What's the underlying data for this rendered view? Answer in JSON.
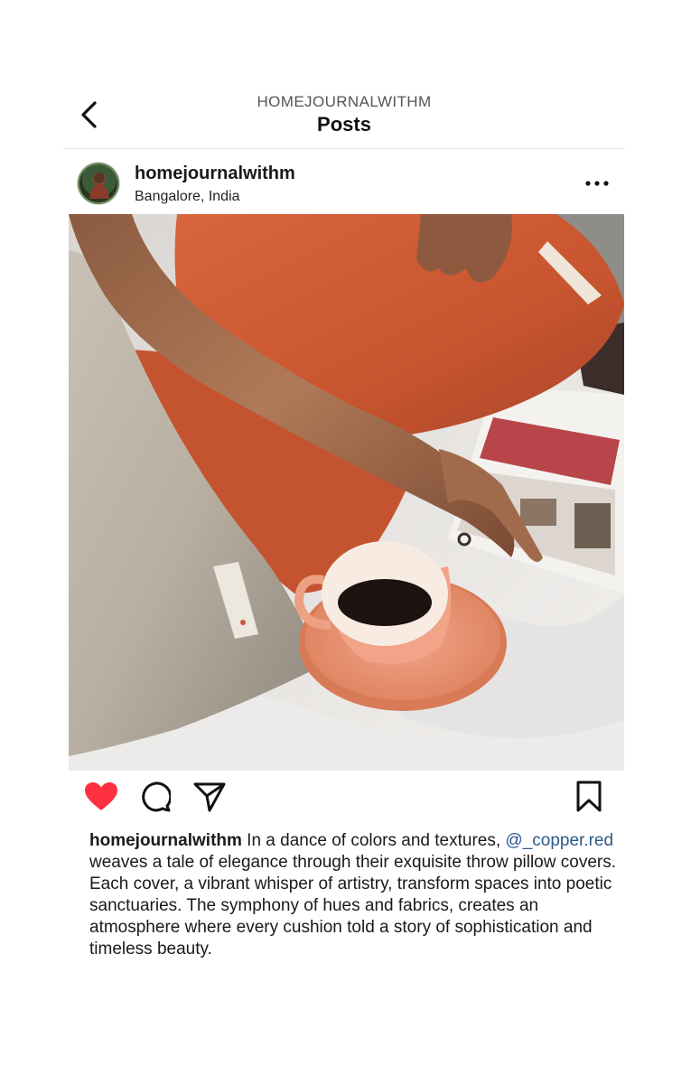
{
  "header": {
    "account": "HOMEJOURNALWITHM",
    "title": "Posts"
  },
  "post": {
    "username": "homejournalwithm",
    "location": "Bangalore, India",
    "caption": {
      "username": "homejournalwithm",
      "text_1": " In a dance of colors and textures, ",
      "mention": "@_copper.red",
      "text_2": " weaves a tale of elegance through their exquisite throw pillow covers. Each cover, a vibrant whisper of artistry, transform spaces into poetic sanctuaries. The symphony of hues and fabrics, creates an atmosphere where every cushion told a story of sophistication and timeless beauty."
    }
  },
  "icons": {
    "back": "chevron-left-icon",
    "more": "ellipsis-icon",
    "like": "heart-icon",
    "comment": "comment-icon",
    "share": "send-icon",
    "save": "bookmark-icon"
  },
  "colors": {
    "like_active": "#ff3040",
    "mention": "#2b5a8a"
  }
}
